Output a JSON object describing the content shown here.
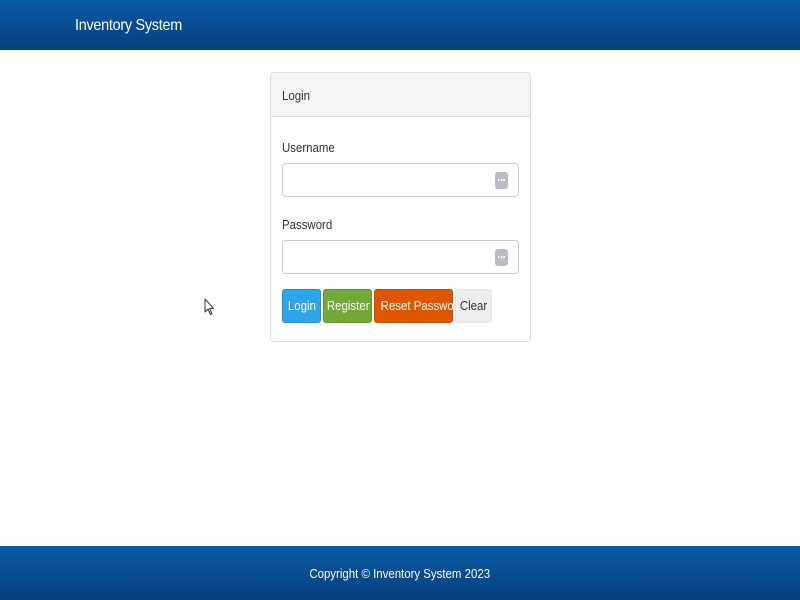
{
  "navbar": {
    "brand": "Inventory System"
  },
  "login_panel": {
    "heading": "Login",
    "username": {
      "label": "Username",
      "value": "",
      "icon": "password-manager-icon"
    },
    "password": {
      "label": "Password",
      "value": "",
      "icon": "password-manager-icon"
    },
    "buttons": {
      "login": "Login",
      "register": "Register",
      "reset_password": "Reset Password",
      "clear": "Clear"
    }
  },
  "footer": {
    "copyright": "Copyright © Inventory System 2023"
  },
  "colors": {
    "navbar": "#0a5aa6",
    "login_button": "#2fa4e7",
    "register_button": "#73a839",
    "reset_button": "#dd5600",
    "clear_button": "#eeeeee"
  }
}
